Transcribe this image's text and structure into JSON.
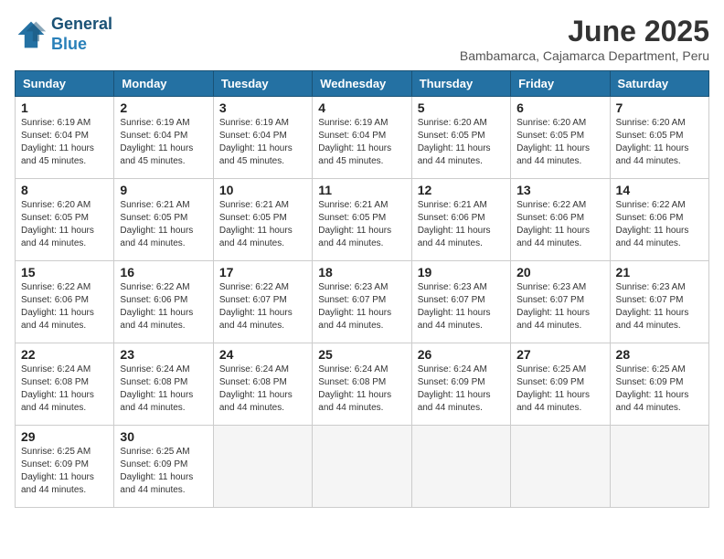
{
  "header": {
    "logo_line1": "General",
    "logo_line2": "Blue",
    "month_title": "June 2025",
    "subtitle": "Bambamarca, Cajamarca Department, Peru"
  },
  "calendar": {
    "days_of_week": [
      "Sunday",
      "Monday",
      "Tuesday",
      "Wednesday",
      "Thursday",
      "Friday",
      "Saturday"
    ],
    "weeks": [
      [
        {
          "day": "1",
          "sunrise": "Sunrise: 6:19 AM",
          "sunset": "Sunset: 6:04 PM",
          "daylight": "Daylight: 11 hours and 45 minutes."
        },
        {
          "day": "2",
          "sunrise": "Sunrise: 6:19 AM",
          "sunset": "Sunset: 6:04 PM",
          "daylight": "Daylight: 11 hours and 45 minutes."
        },
        {
          "day": "3",
          "sunrise": "Sunrise: 6:19 AM",
          "sunset": "Sunset: 6:04 PM",
          "daylight": "Daylight: 11 hours and 45 minutes."
        },
        {
          "day": "4",
          "sunrise": "Sunrise: 6:19 AM",
          "sunset": "Sunset: 6:04 PM",
          "daylight": "Daylight: 11 hours and 45 minutes."
        },
        {
          "day": "5",
          "sunrise": "Sunrise: 6:20 AM",
          "sunset": "Sunset: 6:05 PM",
          "daylight": "Daylight: 11 hours and 44 minutes."
        },
        {
          "day": "6",
          "sunrise": "Sunrise: 6:20 AM",
          "sunset": "Sunset: 6:05 PM",
          "daylight": "Daylight: 11 hours and 44 minutes."
        },
        {
          "day": "7",
          "sunrise": "Sunrise: 6:20 AM",
          "sunset": "Sunset: 6:05 PM",
          "daylight": "Daylight: 11 hours and 44 minutes."
        }
      ],
      [
        {
          "day": "8",
          "sunrise": "Sunrise: 6:20 AM",
          "sunset": "Sunset: 6:05 PM",
          "daylight": "Daylight: 11 hours and 44 minutes."
        },
        {
          "day": "9",
          "sunrise": "Sunrise: 6:21 AM",
          "sunset": "Sunset: 6:05 PM",
          "daylight": "Daylight: 11 hours and 44 minutes."
        },
        {
          "day": "10",
          "sunrise": "Sunrise: 6:21 AM",
          "sunset": "Sunset: 6:05 PM",
          "daylight": "Daylight: 11 hours and 44 minutes."
        },
        {
          "day": "11",
          "sunrise": "Sunrise: 6:21 AM",
          "sunset": "Sunset: 6:05 PM",
          "daylight": "Daylight: 11 hours and 44 minutes."
        },
        {
          "day": "12",
          "sunrise": "Sunrise: 6:21 AM",
          "sunset": "Sunset: 6:06 PM",
          "daylight": "Daylight: 11 hours and 44 minutes."
        },
        {
          "day": "13",
          "sunrise": "Sunrise: 6:22 AM",
          "sunset": "Sunset: 6:06 PM",
          "daylight": "Daylight: 11 hours and 44 minutes."
        },
        {
          "day": "14",
          "sunrise": "Sunrise: 6:22 AM",
          "sunset": "Sunset: 6:06 PM",
          "daylight": "Daylight: 11 hours and 44 minutes."
        }
      ],
      [
        {
          "day": "15",
          "sunrise": "Sunrise: 6:22 AM",
          "sunset": "Sunset: 6:06 PM",
          "daylight": "Daylight: 11 hours and 44 minutes."
        },
        {
          "day": "16",
          "sunrise": "Sunrise: 6:22 AM",
          "sunset": "Sunset: 6:06 PM",
          "daylight": "Daylight: 11 hours and 44 minutes."
        },
        {
          "day": "17",
          "sunrise": "Sunrise: 6:22 AM",
          "sunset": "Sunset: 6:07 PM",
          "daylight": "Daylight: 11 hours and 44 minutes."
        },
        {
          "day": "18",
          "sunrise": "Sunrise: 6:23 AM",
          "sunset": "Sunset: 6:07 PM",
          "daylight": "Daylight: 11 hours and 44 minutes."
        },
        {
          "day": "19",
          "sunrise": "Sunrise: 6:23 AM",
          "sunset": "Sunset: 6:07 PM",
          "daylight": "Daylight: 11 hours and 44 minutes."
        },
        {
          "day": "20",
          "sunrise": "Sunrise: 6:23 AM",
          "sunset": "Sunset: 6:07 PM",
          "daylight": "Daylight: 11 hours and 44 minutes."
        },
        {
          "day": "21",
          "sunrise": "Sunrise: 6:23 AM",
          "sunset": "Sunset: 6:07 PM",
          "daylight": "Daylight: 11 hours and 44 minutes."
        }
      ],
      [
        {
          "day": "22",
          "sunrise": "Sunrise: 6:24 AM",
          "sunset": "Sunset: 6:08 PM",
          "daylight": "Daylight: 11 hours and 44 minutes."
        },
        {
          "day": "23",
          "sunrise": "Sunrise: 6:24 AM",
          "sunset": "Sunset: 6:08 PM",
          "daylight": "Daylight: 11 hours and 44 minutes."
        },
        {
          "day": "24",
          "sunrise": "Sunrise: 6:24 AM",
          "sunset": "Sunset: 6:08 PM",
          "daylight": "Daylight: 11 hours and 44 minutes."
        },
        {
          "day": "25",
          "sunrise": "Sunrise: 6:24 AM",
          "sunset": "Sunset: 6:08 PM",
          "daylight": "Daylight: 11 hours and 44 minutes."
        },
        {
          "day": "26",
          "sunrise": "Sunrise: 6:24 AM",
          "sunset": "Sunset: 6:09 PM",
          "daylight": "Daylight: 11 hours and 44 minutes."
        },
        {
          "day": "27",
          "sunrise": "Sunrise: 6:25 AM",
          "sunset": "Sunset: 6:09 PM",
          "daylight": "Daylight: 11 hours and 44 minutes."
        },
        {
          "day": "28",
          "sunrise": "Sunrise: 6:25 AM",
          "sunset": "Sunset: 6:09 PM",
          "daylight": "Daylight: 11 hours and 44 minutes."
        }
      ],
      [
        {
          "day": "29",
          "sunrise": "Sunrise: 6:25 AM",
          "sunset": "Sunset: 6:09 PM",
          "daylight": "Daylight: 11 hours and 44 minutes."
        },
        {
          "day": "30",
          "sunrise": "Sunrise: 6:25 AM",
          "sunset": "Sunset: 6:09 PM",
          "daylight": "Daylight: 11 hours and 44 minutes."
        },
        {
          "day": "",
          "sunrise": "",
          "sunset": "",
          "daylight": ""
        },
        {
          "day": "",
          "sunrise": "",
          "sunset": "",
          "daylight": ""
        },
        {
          "day": "",
          "sunrise": "",
          "sunset": "",
          "daylight": ""
        },
        {
          "day": "",
          "sunrise": "",
          "sunset": "",
          "daylight": ""
        },
        {
          "day": "",
          "sunrise": "",
          "sunset": "",
          "daylight": ""
        }
      ]
    ]
  }
}
